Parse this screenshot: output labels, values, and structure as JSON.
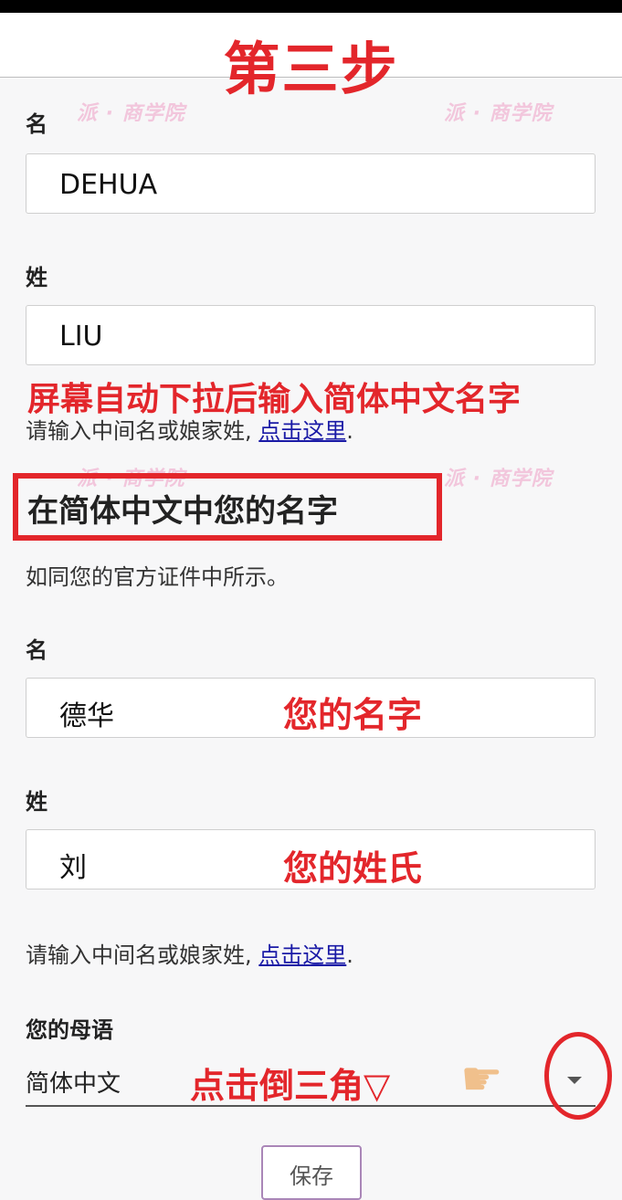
{
  "header": {
    "step_title": "第三步"
  },
  "watermarks": [
    "派 · 商学院",
    "派 · 商学院",
    "派 · 商学院",
    "派 · 商学院"
  ],
  "english_name": {
    "first_label": "名",
    "first_value": "DEHUA",
    "last_label": "姓",
    "last_value": "LIU",
    "help_text": "请输入中间名或娘家姓,",
    "help_link": "点击这里",
    "help_end": "."
  },
  "annotations": {
    "auto_scroll": "屏幕自动下拉后输入简体中文名字",
    "your_first_name": "您的名字",
    "your_surname": "您的姓氏",
    "click_triangle": "点击倒三角▽"
  },
  "chinese_name": {
    "section_title": "在简体中文中您的名字",
    "subtitle": "如同您的官方证件中所示。",
    "first_label": "名",
    "first_value": "德华",
    "last_label": "姓",
    "last_value": "刘",
    "help_text": "请输入中间名或娘家姓,",
    "help_link": "点击这里",
    "help_end": "."
  },
  "native_language": {
    "label": "您的母语",
    "selected": "简体中文"
  },
  "save_button": {
    "label": "保存"
  },
  "icons": {
    "dropdown": "caret-down-icon",
    "hand": "pointing-hand-icon"
  },
  "colors": {
    "annotation_red": "#e3262b",
    "link_blue": "#1a1aa6",
    "watermark_pink": "#f2c6dc"
  }
}
